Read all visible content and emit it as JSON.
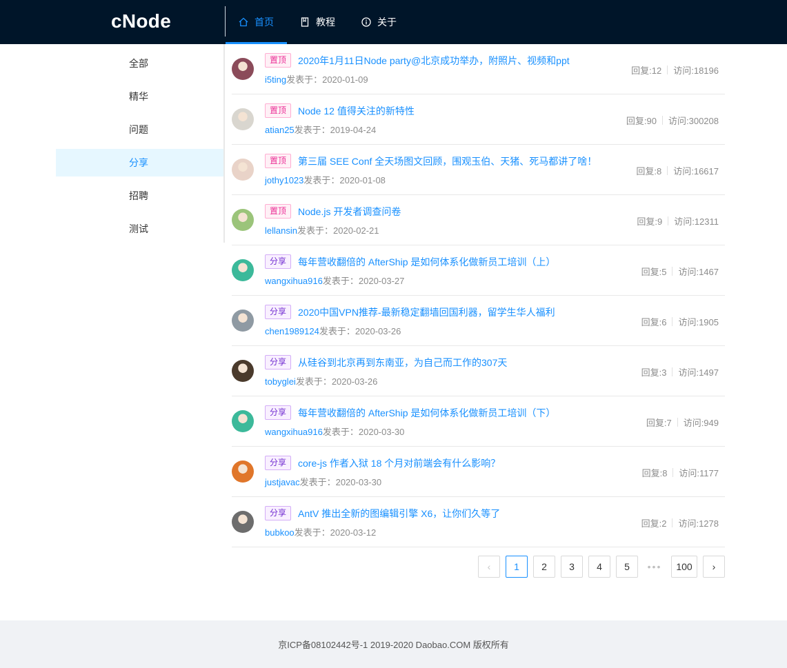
{
  "brand": {
    "logo": "cNode"
  },
  "nav": [
    {
      "label": "首页",
      "icon": "home-icon",
      "active": true
    },
    {
      "label": "教程",
      "icon": "book-icon",
      "active": false
    },
    {
      "label": "关于",
      "icon": "info-circle-icon",
      "active": false
    }
  ],
  "sidebar": {
    "items": [
      {
        "label": "全部"
      },
      {
        "label": "精华"
      },
      {
        "label": "问题"
      },
      {
        "label": "分享",
        "active": true
      },
      {
        "label": "招聘"
      },
      {
        "label": "测试"
      }
    ]
  },
  "topics": [
    {
      "tag": "置顶",
      "tag_type": "top",
      "title": "2020年1月11日Node party@北京成功举办，附照片、视频和ppt",
      "author": "i5ting",
      "published_label": "发表于：",
      "date": "2020-01-09",
      "replies_label": "回复:12",
      "views_label": "访问:18196",
      "avatar_color": "#8b4b5a"
    },
    {
      "tag": "置顶",
      "tag_type": "top",
      "title": "Node 12 值得关注的新特性",
      "author": "atian25",
      "published_label": "发表于：",
      "date": "2019-04-24",
      "replies_label": "回复:90",
      "views_label": "访问:300208",
      "avatar_color": "#d9d6cf"
    },
    {
      "tag": "置顶",
      "tag_type": "top",
      "title": "第三届 SEE Conf 全天场图文回顾，围观玉伯、天猪、死马都讲了啥！",
      "author": "jothy1023",
      "published_label": "发表于：",
      "date": "2020-01-08",
      "replies_label": "回复:8",
      "views_label": "访问:16617",
      "avatar_color": "#e9d3c8"
    },
    {
      "tag": "置顶",
      "tag_type": "top",
      "title": "Node.js 开发者调查问卷",
      "author": "lellansin",
      "published_label": "发表于：",
      "date": "2020-02-21",
      "replies_label": "回复:9",
      "views_label": "访问:12311",
      "avatar_color": "#9bc47a"
    },
    {
      "tag": "分享",
      "tag_type": "share",
      "title": "每年营收翻倍的 AfterShip 是如何体系化做新员工培训（上）",
      "author": "wangxihua916",
      "published_label": "发表于：",
      "date": "2020-03-27",
      "replies_label": "回复:5",
      "views_label": "访问:1467",
      "avatar_color": "#3cb99a"
    },
    {
      "tag": "分享",
      "tag_type": "share",
      "title": "2020中国VPN推荐-最新稳定翻墙回国利器，留学生华人福利",
      "author": "chen1989124",
      "published_label": "发表于：",
      "date": "2020-03-26",
      "replies_label": "回复:6",
      "views_label": "访问:1905",
      "avatar_color": "#8f9aa3"
    },
    {
      "tag": "分享",
      "tag_type": "share",
      "title": "从硅谷到北京再到东南亚，为自己而工作的307天",
      "author": "tobyglei",
      "published_label": "发表于：",
      "date": "2020-03-26",
      "replies_label": "回复:3",
      "views_label": "访问:1497",
      "avatar_color": "#4a3a2c"
    },
    {
      "tag": "分享",
      "tag_type": "share",
      "title": "每年营收翻倍的 AfterShip 是如何体系化做新员工培训（下）",
      "author": "wangxihua916",
      "published_label": "发表于：",
      "date": "2020-03-30",
      "replies_label": "回复:7",
      "views_label": "访问:949",
      "avatar_color": "#3cb99a"
    },
    {
      "tag": "分享",
      "tag_type": "share",
      "title": "core-js 作者入狱 18 个月对前端会有什么影响？",
      "author": "justjavac",
      "published_label": "发表于：",
      "date": "2020-03-30",
      "replies_label": "回复:8",
      "views_label": "访问:1177",
      "avatar_color": "#e0762a"
    },
    {
      "tag": "分享",
      "tag_type": "share",
      "title": "AntV 推出全新的图编辑引擎 X6，让你们久等了",
      "author": "bubkoo",
      "published_label": "发表于：",
      "date": "2020-03-12",
      "replies_label": "回复:2",
      "views_label": "访问:1278",
      "avatar_color": "#6d6d6d"
    }
  ],
  "pagination": {
    "prev": "‹",
    "pages": [
      "1",
      "2",
      "3",
      "4",
      "5"
    ],
    "current": "1",
    "ellipsis": "•••",
    "last": "100",
    "next": "›"
  },
  "footer": {
    "text": "京ICP备08102442号-1 2019-2020 Daobao.COM 版权所有"
  },
  "colors": {
    "header_bg": "#001529",
    "accent": "#1890ff",
    "top_tag": "#eb2f96",
    "share_tag": "#722ed1"
  }
}
